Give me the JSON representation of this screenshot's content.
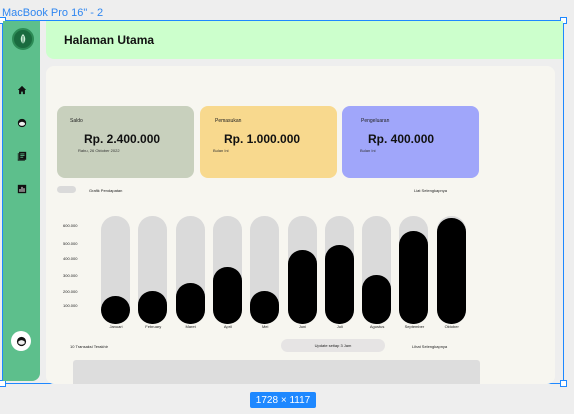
{
  "canvas": {
    "frame_label": "MacBook Pro 16\" - 2",
    "dimensions_badge": "1728 × 1117"
  },
  "header": {
    "title": "Halaman Utama"
  },
  "sidebar": {
    "items": [
      {
        "name": "home",
        "icon": "home-icon"
      },
      {
        "name": "user",
        "icon": "user-icon"
      },
      {
        "name": "document",
        "icon": "document-icon"
      },
      {
        "name": "chart",
        "icon": "bar-chart-icon"
      }
    ],
    "bottom_icon": "user-icon"
  },
  "cards": {
    "saldo": {
      "label": "Saldo",
      "value": "Rp. 2.400.000",
      "sub": "Rabu, 26 Oktober 2022",
      "color": "#c8d0bd"
    },
    "pemasukan": {
      "label": "Pemasukan",
      "value": "Rp. 1.000.000",
      "sub": "Bulan Ini",
      "color": "#f8d98e"
    },
    "pengeluaran": {
      "label": "Pengeluaran",
      "value": "Rp. 400.000",
      "sub": "Bulan Ini",
      "color": "#a0a6fa"
    }
  },
  "chart_section": {
    "title": "Grafik Pendapatan",
    "link": "Liat Selengkapnya"
  },
  "chart_data": {
    "type": "bar",
    "categories": [
      "Januari",
      "February",
      "Maret",
      "April",
      "Mei",
      "Juni",
      "Juli",
      "Agustus",
      "September",
      "Oktober"
    ],
    "values": [
      170000,
      200000,
      250000,
      350000,
      200000,
      450000,
      480000,
      300000,
      570000,
      650000
    ],
    "yticks": [
      "600.000",
      "500.000",
      "400.000",
      "300.000",
      "200.000",
      "100.000"
    ],
    "ylim": [
      0,
      660000
    ],
    "bar_color": "#000000",
    "track_color": "#dadada"
  },
  "transactions": {
    "title": "10 Transaksi Terakhir",
    "update_label": "Update setiap 3 Jam",
    "link": "Lihat Selengkapnya"
  }
}
